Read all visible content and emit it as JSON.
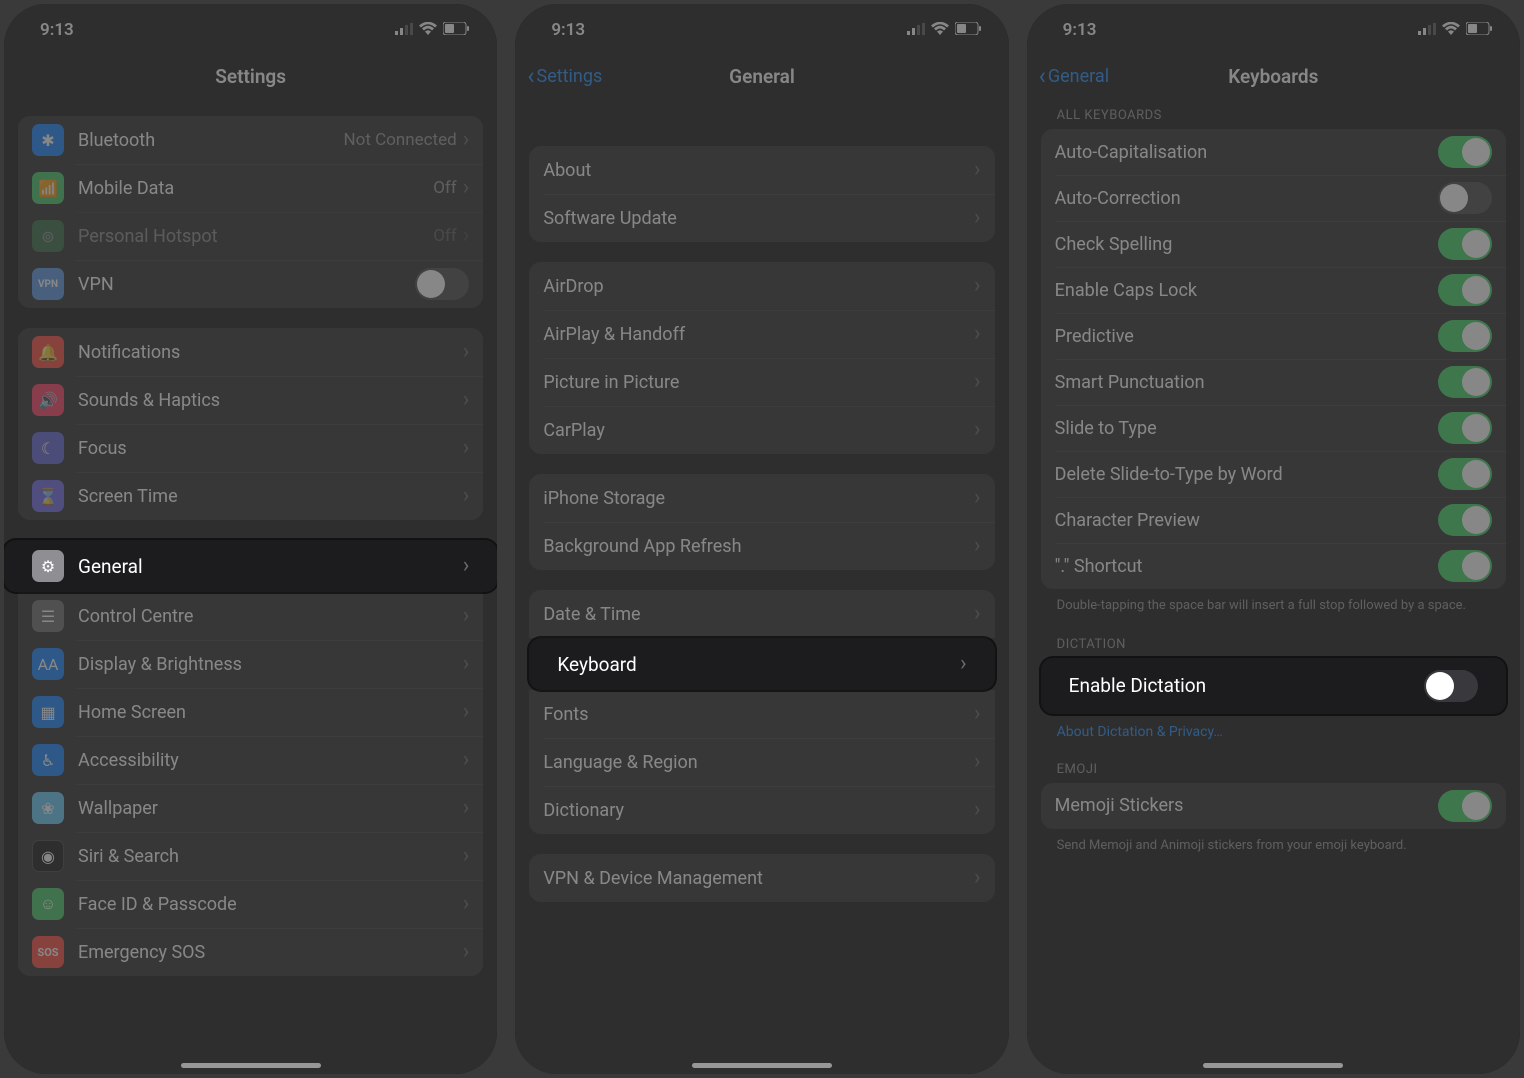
{
  "status": {
    "time": "9:13"
  },
  "screen1": {
    "title": "Settings",
    "rows_group1": [
      {
        "icon": "bluetooth-icon",
        "bg": "bg-blue",
        "glyph": "✱",
        "label": "Bluetooth",
        "value": "Not Connected",
        "type": "disclosure"
      },
      {
        "icon": "cellular-icon",
        "bg": "bg-green",
        "glyph": "📶",
        "label": "Mobile Data",
        "value": "Off",
        "type": "disclosure"
      },
      {
        "icon": "hotspot-icon",
        "bg": "bg-green2",
        "glyph": "⊚",
        "label": "Personal Hotspot",
        "value": "Off",
        "type": "disclosure",
        "dim": true
      },
      {
        "icon": "vpn-icon",
        "bg": "bg-vpn",
        "glyph": "VPN",
        "label": "VPN",
        "type": "toggle",
        "on": false
      }
    ],
    "rows_group2": [
      {
        "icon": "bell-icon",
        "bg": "bg-red",
        "glyph": "🔔",
        "label": "Notifications"
      },
      {
        "icon": "speaker-icon",
        "bg": "bg-pink",
        "glyph": "🔊",
        "label": "Sounds & Haptics"
      },
      {
        "icon": "moon-icon",
        "bg": "bg-indigo",
        "glyph": "☾",
        "label": "Focus"
      },
      {
        "icon": "hourglass-icon",
        "bg": "bg-purple",
        "glyph": "⌛",
        "label": "Screen Time"
      }
    ],
    "highlight": {
      "icon": "gear-icon",
      "bg": "bg-gray",
      "glyph": "⚙",
      "label": "General"
    },
    "rows_group3": [
      {
        "icon": "switches-icon",
        "bg": "bg-gray2",
        "glyph": "☰",
        "label": "Control Centre"
      },
      {
        "icon": "text-icon",
        "bg": "bg-blue",
        "glyph": "AA",
        "label": "Display & Brightness"
      },
      {
        "icon": "grid-icon",
        "bg": "bg-teal",
        "glyph": "▦",
        "label": "Home Screen"
      },
      {
        "icon": "accessibility-icon",
        "bg": "bg-blue",
        "glyph": "♿︎",
        "label": "Accessibility"
      },
      {
        "icon": "wallpaper-icon",
        "bg": "bg-lblue",
        "glyph": "❀",
        "label": "Wallpaper"
      },
      {
        "icon": "siri-icon",
        "bg": "bg-black",
        "glyph": "◉",
        "label": "Siri & Search"
      },
      {
        "icon": "faceid-icon",
        "bg": "bg-green",
        "glyph": "☺︎",
        "label": "Face ID & Passcode"
      },
      {
        "icon": "sos-icon",
        "bg": "bg-sos",
        "glyph": "SOS",
        "label": "Emergency SOS"
      }
    ]
  },
  "screen2": {
    "back": "Settings",
    "title": "General",
    "group1": [
      "About",
      "Software Update"
    ],
    "group2": [
      "AirDrop",
      "AirPlay & Handoff",
      "Picture in Picture",
      "CarPlay"
    ],
    "group3": [
      "iPhone Storage",
      "Background App Refresh"
    ],
    "group4_pre": [
      "Date & Time"
    ],
    "highlight": "Keyboard",
    "group4_post": [
      "Fonts",
      "Language & Region",
      "Dictionary"
    ],
    "group5": [
      "VPN & Device Management"
    ]
  },
  "screen3": {
    "back": "General",
    "title": "Keyboards",
    "section1_header": "ALL KEYBOARDS",
    "toggles1": [
      {
        "label": "Auto-Capitalisation",
        "on": true
      },
      {
        "label": "Auto-Correction",
        "on": false
      },
      {
        "label": "Check Spelling",
        "on": true
      },
      {
        "label": "Enable Caps Lock",
        "on": true
      },
      {
        "label": "Predictive",
        "on": true
      },
      {
        "label": "Smart Punctuation",
        "on": true
      },
      {
        "label": "Slide to Type",
        "on": true
      },
      {
        "label": "Delete Slide-to-Type by Word",
        "on": true
      },
      {
        "label": "Character Preview",
        "on": true
      },
      {
        "label": "\".\" Shortcut",
        "on": true
      }
    ],
    "footer1": "Double-tapping the space bar will insert a full stop followed by a space.",
    "section2_header": "DICTATION",
    "highlight": {
      "label": "Enable Dictation",
      "on": false
    },
    "link": "About Dictation & Privacy…",
    "section3_header": "EMOJI",
    "toggles3": [
      {
        "label": "Memoji Stickers",
        "on": true
      }
    ],
    "footer3": "Send Memoji and Animoji stickers from your emoji keyboard."
  }
}
